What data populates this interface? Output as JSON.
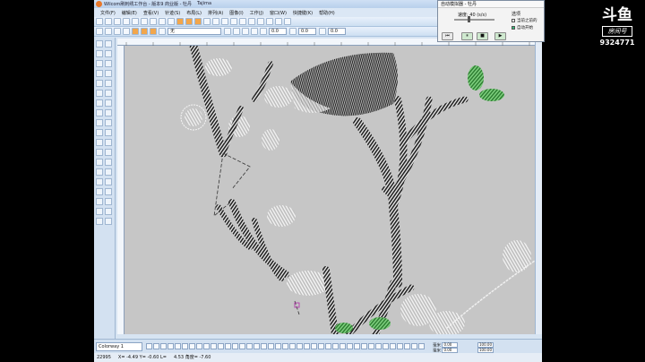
{
  "app": {
    "title": "Wilcom刷刺绣工作台 - 版本9 商业版 - 牡丹",
    "doc_title": "Tajima"
  },
  "menu": [
    "文件(F)",
    "编辑(E)",
    "查看(V)",
    "针迹(S)",
    "布局(L)",
    "排列(A)",
    "图像(I)",
    "工作(J)",
    "窗口(W)",
    "快捷键(K)",
    "帮助(H)"
  ],
  "toolbar2": {
    "stitch_combo": "无",
    "value_a": "0.0",
    "value_b": "0.0",
    "value_c": "0.0"
  },
  "colorway": "Colorway 1",
  "status": {
    "stitches": "22995",
    "x": "X= -4.49 Y= -0.60 L=",
    "l": "4.53 角度= -7.60"
  },
  "coord_panel": {
    "a_label": "毫米",
    "b_label": "毫米",
    "a_val": "0.00",
    "b_val": "0.00",
    "pct_a": "100.00",
    "pct_b": "100.00"
  },
  "player": {
    "title": "自动模拟器 - 牡丹",
    "speed_label": "速度:",
    "speed_value": "40 (s/s)",
    "options_label": "选项",
    "option_1": "当前之前的",
    "option_2": "自动开始",
    "option_2_checked": true
  },
  "stream": {
    "platform_mark": "斗鱼",
    "room_label": "房间号",
    "room_id": "9324771"
  },
  "colors": {
    "app_bg": "#d7e4f2",
    "canvas_bg": "#c6c6c6",
    "leaf_green": "#4aa84c",
    "stitch_dark": "#2b2b2b",
    "stitch_light": "#f4f4f4"
  }
}
